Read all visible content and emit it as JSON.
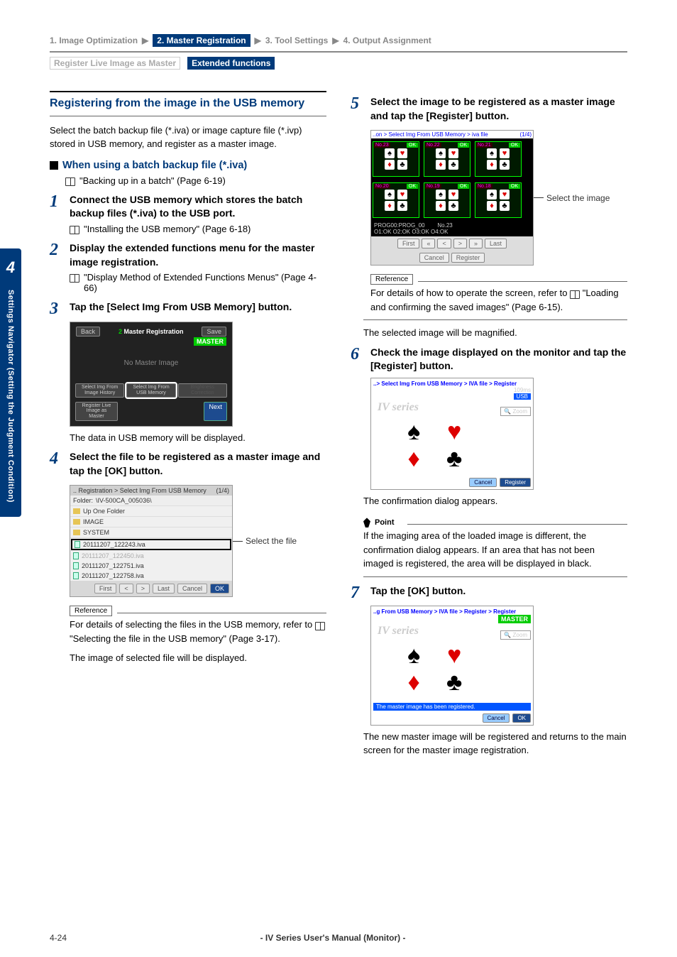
{
  "breadcrumb": {
    "step1": "1. Image Optimization",
    "step2": "2. Master Registration",
    "step3": "3. Tool Settings",
    "step4": "4. Output Assignment"
  },
  "subcrumb": {
    "left": "Register Live Image as Master",
    "right": "Extended functions"
  },
  "side_tab": {
    "chapter": "4",
    "label": "Settings Navigator (Setting the Judgment Condition)"
  },
  "section": {
    "title": "Registering from the image in the USB memory",
    "intro": "Select the batch backup file (*.iva) or image capture file (*.ivp) stored in USB memory, and register as a master image.",
    "sub_heading": "When using a batch backup file (*.iva)",
    "sub_ref": "\"Backing up in a batch\" (Page 6-19)"
  },
  "steps": {
    "s1": {
      "title": "Connect the USB memory which stores the batch backup files (*.iva) to the USB port.",
      "ref": "\"Installing the USB memory\" (Page 6-18)"
    },
    "s2": {
      "title": "Display the extended functions menu for the master image registration.",
      "ref": "\"Display Method of Extended Functions Menus\" (Page 4-66)"
    },
    "s3": {
      "title": "Tap the [Select Img From USB Memory] button.",
      "after": "The data in USB memory will be displayed."
    },
    "s4": {
      "title": "Select the file to be registered as a master image and tap the [OK] button.",
      "callout": "Select the file",
      "ref_box_text": "For details of selecting the files in the USB memory, refer to     \"Selecting the file in the USB memory\" (Page 3-17).",
      "after": "The image of selected file will be displayed."
    },
    "s5": {
      "title": "Select the image to be registered as a master image and tap the [Register] button.",
      "callout": "Select the image",
      "ref_box_text": "For details of how to operate the screen, refer to     \"Loading and confirming the saved images\" (Page 6-15).",
      "after": "The selected image will be magnified."
    },
    "s6": {
      "title": "Check the image displayed on the monitor and tap the [Register] button.",
      "after": "The confirmation dialog appears.",
      "point": "If the imaging area of the loaded image is different, the confirmation dialog appears. If an area that has not been imaged is registered, the area will be displayed in black."
    },
    "s7": {
      "title": "Tap the [OK] button.",
      "after": "The new master image will be registered and returns to the main screen for the master image registration."
    }
  },
  "screenshot3": {
    "back": "Back",
    "title": "Master Registration",
    "save": "Save",
    "master": "MASTER",
    "no_image": "No Master Image",
    "btn_history": "Select Img From Image History",
    "btn_usb": "Select Img From USB Memory",
    "btn_bright": "Brightness Correction",
    "btn_reglive": "Register Live Image as Master",
    "next": "Next"
  },
  "screenshot4": {
    "hdr_left": ".. Registration > Select Img From USB Memory",
    "hdr_right": "(1/4)",
    "folder_label": "Folder:",
    "folder_path": "\\IV-500CA_005036\\",
    "up": "Up One Folder",
    "dir_image": "IMAGE",
    "dir_system": "SYSTEM",
    "file1": "20111207_122243.iva",
    "file2": "20111207_122450.iva",
    "file3": "20111207_122751.iva",
    "file4": "20111207_122758.iva",
    "first": "First",
    "last": "Last",
    "cancel": "Cancel",
    "ok": "OK"
  },
  "screenshot5": {
    "hdr_left": "..on > Select Img From USB Memory > iva file",
    "hdr_right": "(1/4)",
    "ok": "OK",
    "t1": "No.23",
    "t2": "No.22",
    "t3": "No.21",
    "t4": "No.20",
    "t5": "No.19",
    "t6": "No.18",
    "prog": "PROG00:PROG_00",
    "num": "No.23",
    "stats": "O1:OK  O2:OK  O3:OK  O4:OK",
    "first": "First",
    "last": "Last",
    "cancel": "Cancel",
    "register": "Register"
  },
  "screenshot6": {
    "hdr": "..> Select Img From USB Memory > IVA file > Register",
    "usb": "USB",
    "ms": "109ms",
    "logo": "IV series",
    "zoom": "Zoom",
    "cancel": "Cancel",
    "register": "Register"
  },
  "screenshot7": {
    "hdr": "..g From USB Memory > IVA file > Register > Register",
    "master": "MASTER",
    "logo": "IV series",
    "zoom": "Zoom",
    "status": "The master image has been registered.",
    "cancel": "Cancel",
    "ok": "OK"
  },
  "labels": {
    "reference": "Reference",
    "point": "Point"
  },
  "footer": {
    "page": "4-24",
    "center": "- IV Series User's Manual (Monitor) -"
  }
}
